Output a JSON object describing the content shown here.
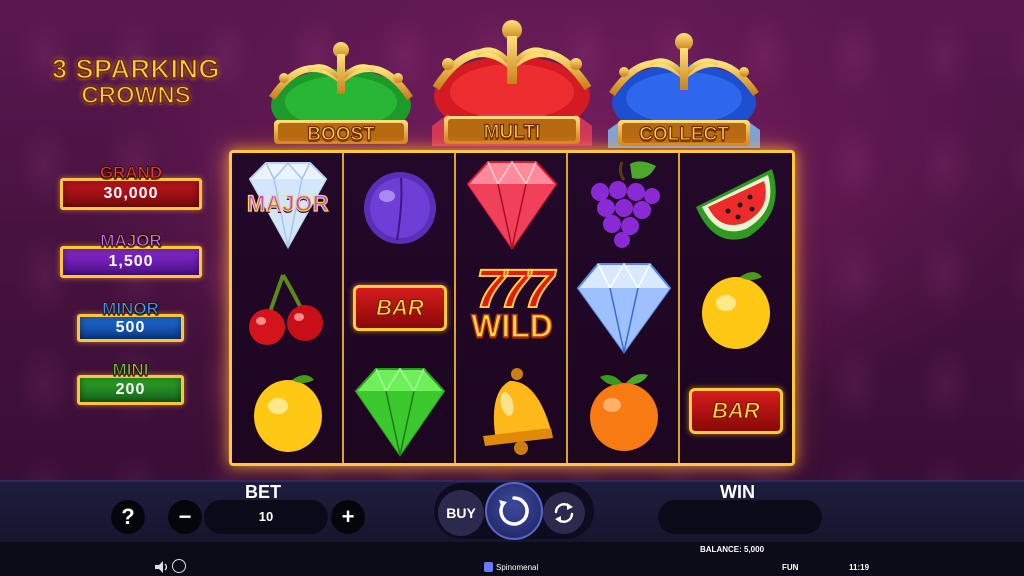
{
  "game": {
    "logo_line1": "3 SPARKING",
    "logo_line2": "CROWNS"
  },
  "crowns": [
    {
      "label": "BOOST",
      "color": "#1c9a2a"
    },
    {
      "label": "MULTI",
      "color": "#d41a22"
    },
    {
      "label": "COLLECT",
      "color": "#1d4fd0"
    }
  ],
  "jackpots": {
    "grand": {
      "label": "GRAND",
      "value": "30,000",
      "color": "#c1161d"
    },
    "major": {
      "label": "MAJOR",
      "value": "1,500",
      "color": "#8a2bd4"
    },
    "minor": {
      "label": "MINOR",
      "value": "500",
      "color": "#1f6ed8"
    },
    "mini": {
      "label": "MINI",
      "value": "200",
      "color": "#2fa62a"
    }
  },
  "reels": {
    "symbols": [
      [
        "diamond-white-major",
        "cherry",
        "lemon"
      ],
      [
        "plum",
        "bar",
        "diamond-green"
      ],
      [
        "diamond-red",
        "wild-777",
        "bell"
      ],
      [
        "grapes",
        "diamond-blue",
        "orange"
      ],
      [
        "watermelon",
        "lemon",
        "bar"
      ]
    ],
    "major_label": "MAJOR",
    "bar_label": "BAR",
    "wild_digits": "777",
    "wild_label": "WILD"
  },
  "controls": {
    "help_label": "?",
    "bet_label": "BET",
    "bet_value": "10",
    "minus_label": "−",
    "plus_label": "+",
    "buy_label": "BUY",
    "win_label": "WIN",
    "win_value": ""
  },
  "footer": {
    "balance_label": "BALANCE: 5,000",
    "brand": "Spinomenal",
    "mode": "FUN",
    "time": "11:19",
    "sound_icon": "speaker-icon",
    "turbo_icon": "turbo-icon"
  }
}
